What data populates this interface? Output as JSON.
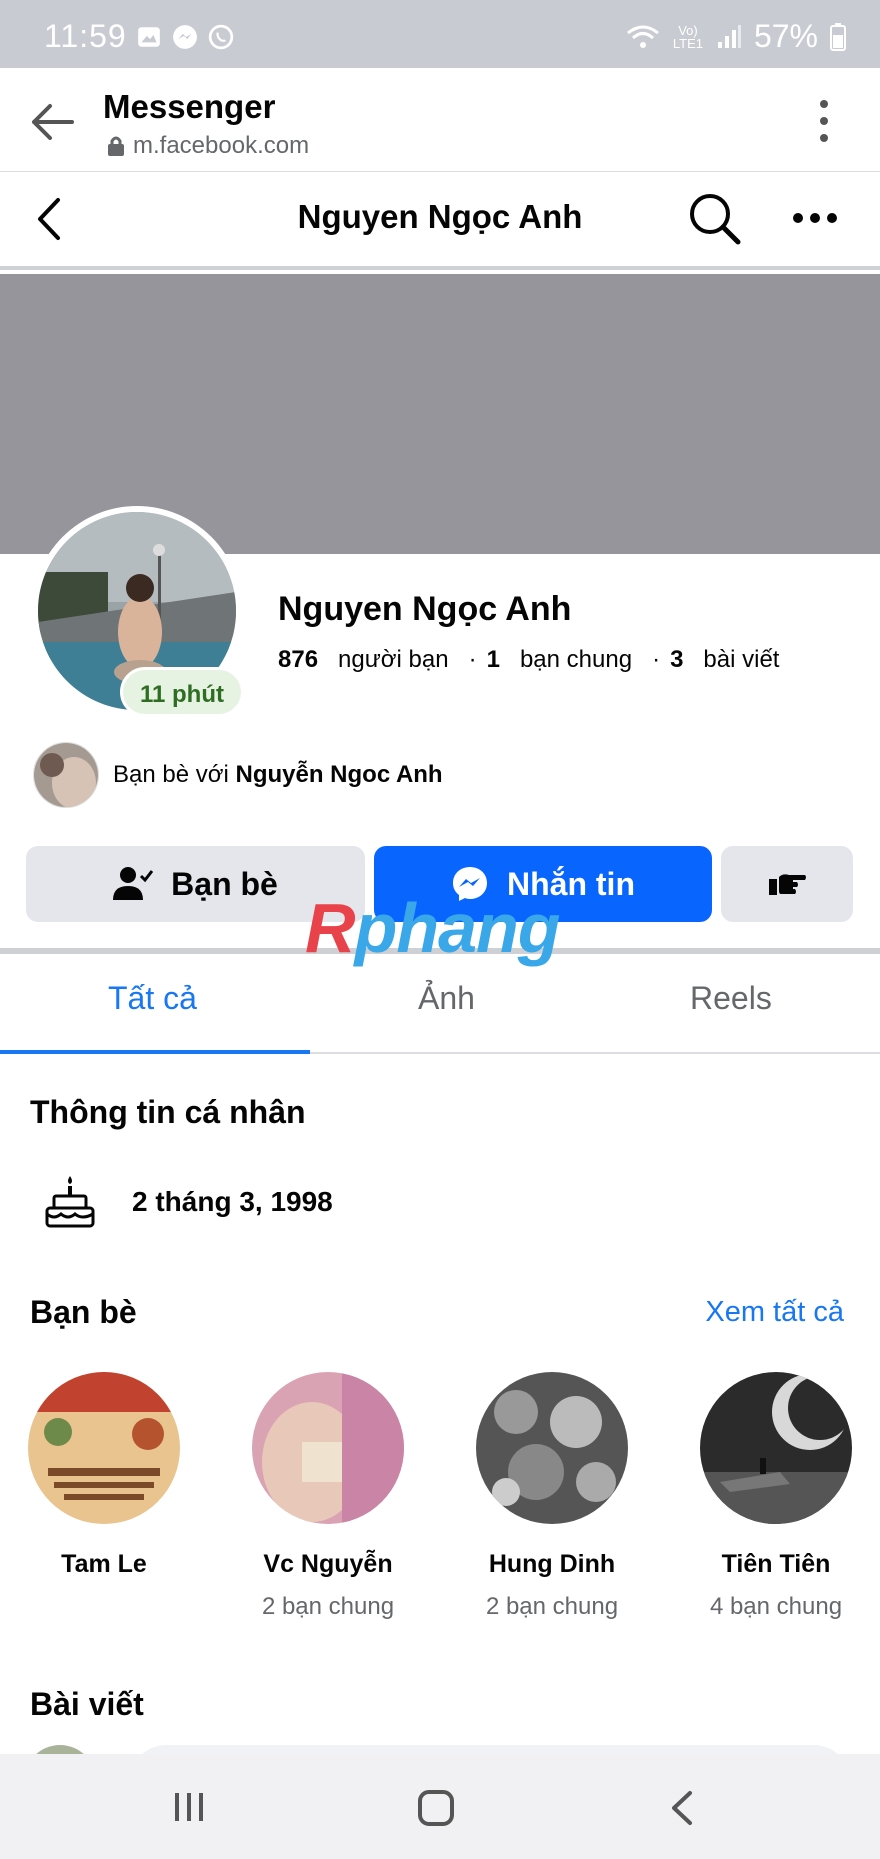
{
  "status": {
    "time": "11:59",
    "battery": "57%",
    "network_label": "Vo) LTE1"
  },
  "browser": {
    "title": "Messenger",
    "url": "m.facebook.com"
  },
  "header": {
    "title": "Nguyen Ngọc Anh"
  },
  "profile": {
    "name": "Nguyen Ngọc Anh",
    "active_badge": "11 phút",
    "friends_count": "876",
    "friends_label": "người bạn",
    "mutual_count": "1",
    "mutual_label": "bạn chung",
    "posts_count": "3",
    "posts_label": "bài viết",
    "separator": "·",
    "mutual_friend_prefix": "Bạn bè với",
    "mutual_friend_name": "Nguyễn Ngoc Anh"
  },
  "actions": {
    "friends_label": "Bạn bè",
    "message_label": "Nhắn tin"
  },
  "watermark": {
    "first": "R",
    "rest": "phang"
  },
  "tabs": [
    {
      "label": "Tất cả",
      "active": true
    },
    {
      "label": "Ảnh",
      "active": false
    },
    {
      "label": "Reels",
      "active": false
    }
  ],
  "info": {
    "title": "Thông tin cá nhân",
    "birthday": "2 tháng 3, 1998"
  },
  "friends_section": {
    "title": "Bạn bè",
    "see_all": "Xem tất cả",
    "items": [
      {
        "name": "Tam Le",
        "mutual": ""
      },
      {
        "name": "Vc Nguyễn",
        "mutual": "2 bạn chung"
      },
      {
        "name": "Hung Dinh",
        "mutual": "2 bạn chung"
      },
      {
        "name": "Tiên Tiên",
        "mutual": "4 bạn chung"
      }
    ]
  },
  "posts_section": {
    "title": "Bài viết"
  },
  "colors": {
    "accent": "#1877f2",
    "message_button": "#0866ff",
    "cover": "#96959b",
    "secondary_button": "#e4e6eb"
  },
  "icons": {
    "back": "arrow-left-icon",
    "lock": "lock-icon",
    "menu": "kebab-menu-icon",
    "search": "search-icon",
    "more": "more-dots-icon",
    "friends": "person-check-icon",
    "messenger": "messenger-icon",
    "poke": "pointing-hand-icon",
    "birthday": "birthday-cake-icon"
  }
}
